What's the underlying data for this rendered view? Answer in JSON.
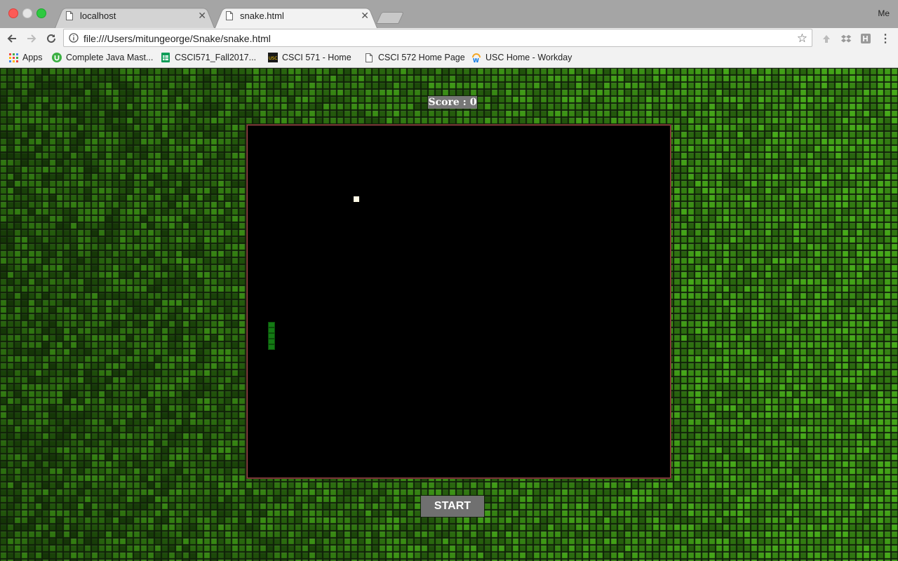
{
  "browser": {
    "tabs": [
      {
        "title": "localhost",
        "active": false
      },
      {
        "title": "snake.html",
        "active": true
      }
    ],
    "profile_label": "Me",
    "url": "file:///Users/mitungeorge/Snake/snake.html",
    "bookmarks": [
      {
        "label": "Apps",
        "icon": "apps-grid-icon"
      },
      {
        "label": "Complete Java Mast...",
        "icon": "udemy-icon"
      },
      {
        "label": "CSCI571_Fall2017...",
        "icon": "sheets-icon"
      },
      {
        "label": "CSCI 571 - Home",
        "icon": "usc-icon"
      },
      {
        "label": "CSCI 572 Home Page",
        "icon": "page-icon"
      },
      {
        "label": "USC Home - Workday",
        "icon": "workday-icon"
      }
    ]
  },
  "game": {
    "score_text": "Score : 0",
    "start_label": "START",
    "colors": {
      "board": "#000000",
      "board_border": "#a04848",
      "snake": "#147a14",
      "food": "#fffbe6",
      "background": "#2e5a16"
    }
  }
}
